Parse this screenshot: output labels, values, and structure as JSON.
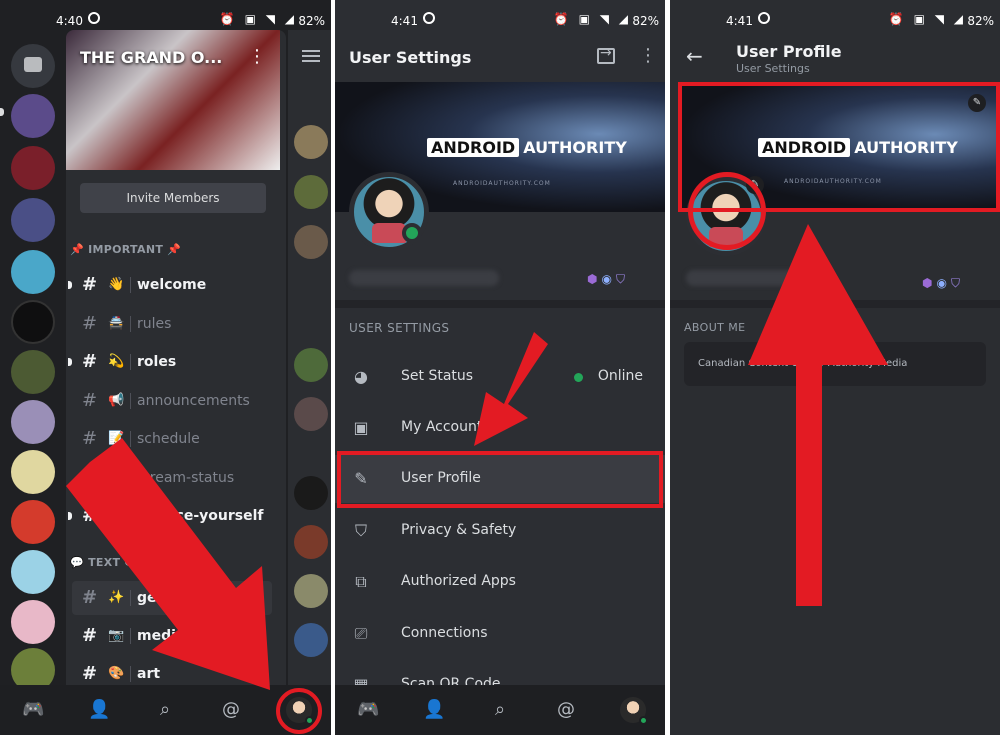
{
  "colors": {
    "annotation_red": "#e31b23",
    "online_green": "#23a559",
    "background_dark": "#2b2d31"
  },
  "panel1": {
    "status": {
      "time": "4:40",
      "battery": "82%"
    },
    "server": {
      "name": "THE GRAND O...",
      "invite_label": "Invite Members"
    },
    "categories": [
      {
        "label": "📌 IMPORTANT 📌"
      },
      {
        "label": "💬 TEXT CHAN..."
      }
    ],
    "channels": [
      {
        "emoji": "👋",
        "name": "welcome",
        "bold": true
      },
      {
        "emoji": "🚔",
        "name": "rules",
        "bold": false
      },
      {
        "emoji": "💫",
        "name": "roles",
        "bold": true
      },
      {
        "emoji": "📢",
        "name": "announcements",
        "bold": false
      },
      {
        "emoji": "📝",
        "name": "schedule",
        "bold": false
      },
      {
        "emoji": "",
        "name": "stream-status",
        "bold": false
      },
      {
        "emoji": "🔥",
        "name": "...oduce-yourself",
        "bold": true
      },
      {
        "emoji": "✨",
        "name": "genera...",
        "bold": true,
        "active": true
      },
      {
        "emoji": "📷",
        "name": "media",
        "bold": true
      },
      {
        "emoji": "🎨",
        "name": "art",
        "bold": true
      }
    ],
    "bottom_nav": [
      "discord-home-icon",
      "friends-icon",
      "search-icon",
      "mentions-icon",
      "profile-avatar"
    ]
  },
  "panel2": {
    "status": {
      "time": "4:41",
      "battery": "82%"
    },
    "title": "User Settings",
    "banner": {
      "brand_bold": "ANDROID",
      "brand_rest": "AUTHORITY",
      "brand_sub": "ANDROIDAUTHORITY.COM"
    },
    "section_label": "USER SETTINGS",
    "rows": [
      {
        "icon": "status-icon",
        "label": "Set Status",
        "value": "Online"
      },
      {
        "icon": "account-icon",
        "label": "My Account",
        "value": ""
      },
      {
        "icon": "pencil-icon",
        "label": "User Profile",
        "value": "",
        "highlighted": true
      },
      {
        "icon": "shield-icon",
        "label": "Privacy & Safety",
        "value": ""
      },
      {
        "icon": "apps-icon",
        "label": "Authorized Apps",
        "value": ""
      },
      {
        "icon": "connections-icon",
        "label": "Connections",
        "value": ""
      },
      {
        "icon": "qr-icon",
        "label": "Scan QR Code",
        "value": ""
      }
    ]
  },
  "panel3": {
    "status": {
      "time": "4:41",
      "battery": "82%"
    },
    "title": "User Profile",
    "subtitle": "User Settings",
    "banner": {
      "brand_bold": "ANDROID",
      "brand_rest": "AUTHORITY",
      "brand_sub": "ANDROIDAUTHORITY.COM"
    },
    "about_label": "ABOUT ME",
    "about_text": "Canadian Content C... for Authority Media"
  }
}
